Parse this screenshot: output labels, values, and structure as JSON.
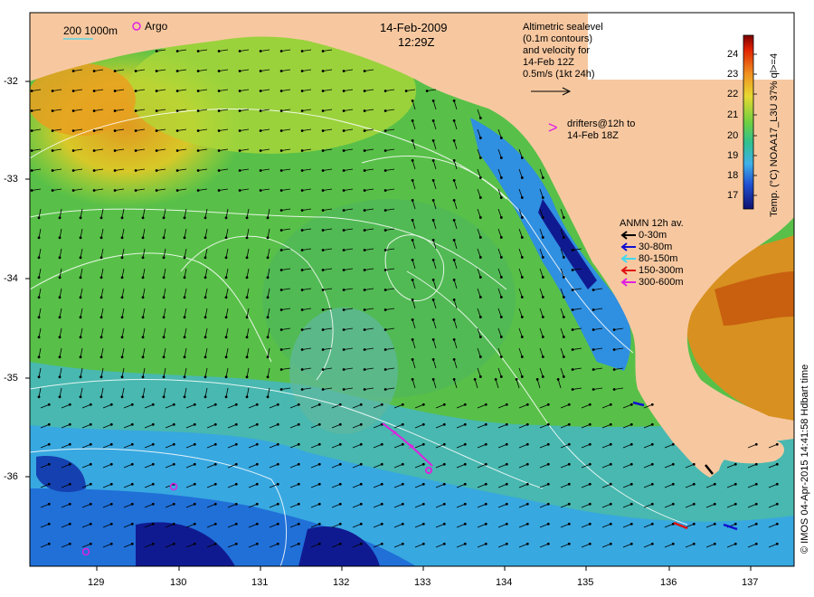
{
  "map": {
    "date": "14-Feb-2009",
    "time": "12:29Z",
    "scale_label": "200  1000m",
    "argo_label": "Argo",
    "sealevel_lines": [
      "Altimetric sealevel",
      "(0.1m contours)",
      "and velocity for",
      "14-Feb 12Z",
      "0.5m/s (1kt 24h)"
    ],
    "drifter_lines": [
      "drifters@12h to",
      "14-Feb 18Z"
    ],
    "drifter_glyph": ">",
    "anmn": {
      "title": "ANMN 12h av.",
      "items": [
        {
          "label": "0-30m",
          "color": "#000000"
        },
        {
          "label": "30-80m",
          "color": "#1010d0"
        },
        {
          "label": "80-150m",
          "color": "#40d8f0"
        },
        {
          "label": "150-300m",
          "color": "#e01010"
        },
        {
          "label": "300-600m",
          "color": "#e020e0"
        }
      ]
    },
    "colorbar": {
      "ticks": [
        "24",
        "23",
        "22",
        "21",
        "20",
        "19",
        "18",
        "17"
      ],
      "label": "Temp. (°C) NOAA17_L3U 37% ql>=4"
    },
    "credit": "© IMOS 04-Apr-2015 14:41:58 Hdbart time",
    "lat_ticks": [
      "-32",
      "-33",
      "-34",
      "-35",
      "-36"
    ],
    "lon_ticks": [
      "129",
      "130",
      "131",
      "132",
      "133",
      "134",
      "135",
      "136",
      "137"
    ],
    "colors": {
      "land": "#f7c8a0",
      "warm": "#e8a020",
      "green": "#50c040",
      "cool": "#40b0e0",
      "cold": "#101a90",
      "argo": "#e020e0"
    }
  }
}
